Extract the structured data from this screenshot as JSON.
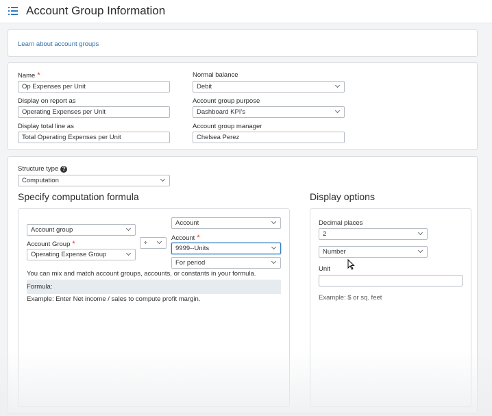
{
  "header": {
    "title": "Account Group Information"
  },
  "info": {
    "learn_link": "Learn about account groups"
  },
  "details": {
    "name": {
      "label": "Name",
      "value": "Op Expenses per Unit"
    },
    "display_on_report": {
      "label": "Display on report as",
      "value": "Operating Expenses per Unit"
    },
    "display_total_line": {
      "label": "Display total line as",
      "value": "Total Operating Expenses per Unit"
    },
    "normal_balance": {
      "label": "Normal balance",
      "value": "Debit"
    },
    "purpose": {
      "label": "Account group purpose",
      "value": "Dashboard KPI's"
    },
    "manager": {
      "label": "Account group manager",
      "value": "Chelsea Perez"
    }
  },
  "structure": {
    "label": "Structure type",
    "value": "Computation",
    "formula_title": "Specify computation formula",
    "left_type": "Account group",
    "account_group_label": "Account Group",
    "account_group_value": "Operating Expense Group",
    "operator": "÷",
    "right_type": "Account",
    "account_label": "Account",
    "account_value": "9999--Units",
    "period": "For period",
    "mix_note": "You can mix and match account groups, accounts, or constants in your formula.",
    "formula_label": "Formula:",
    "example": "Example: Enter Net income / sales to compute profit margin."
  },
  "display_options": {
    "title": "Display options",
    "decimal_label": "Decimal places",
    "decimal_value": "2",
    "format_value": "Number",
    "unit_label": "Unit",
    "unit_value": "",
    "unit_example": "Example: $ or sq. feet"
  },
  "colors": {
    "accent": "#2d7bbf",
    "required": "#d9362b",
    "link": "#2d6fae"
  }
}
